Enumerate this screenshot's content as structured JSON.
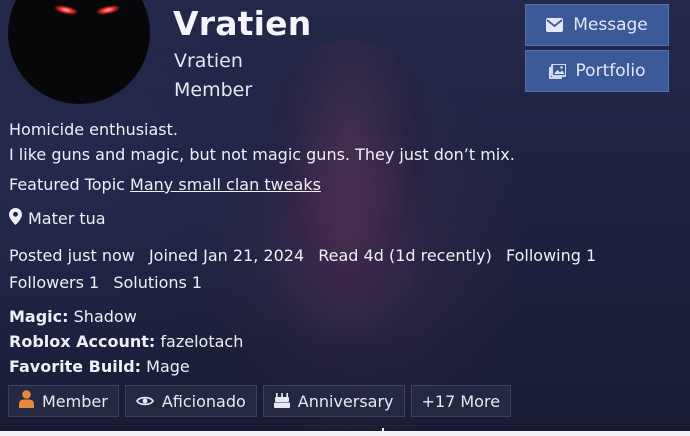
{
  "profile": {
    "display_name": "Vratien",
    "username": "Vratien",
    "title": "Member",
    "bio_line1": "Homicide enthusiast.",
    "bio_line2": "I like guns and magic, but not magic guns. They just don’t mix.",
    "featured_label": "Featured Topic",
    "featured_topic": "Many small clan tweaks",
    "location": "Mater tua"
  },
  "actions": {
    "message_label": "Message",
    "portfolio_label": "Portfolio"
  },
  "stats": {
    "posted": "Posted just now",
    "joined": "Joined Jan 21, 2024",
    "read": "Read 4d (1d recently)",
    "following": "Following 1",
    "followers": "Followers 1",
    "solutions": "Solutions 1"
  },
  "fields": [
    {
      "label": "Magic:",
      "value": "Shadow"
    },
    {
      "label": "Roblox Account:",
      "value": "fazelotach"
    },
    {
      "label": "Favorite Build:",
      "value": "Mage"
    }
  ],
  "badges": [
    {
      "label": "Member",
      "icon": "person-icon",
      "icon_color": "#e8893a"
    },
    {
      "label": "Aficionado",
      "icon": "eye-icon"
    },
    {
      "label": "Anniversary",
      "icon": "cake-icon"
    },
    {
      "label": "+17 More"
    }
  ],
  "colors": {
    "button_bg": "#3b5899",
    "background": "#1c2039",
    "avatar_eyes": "#ff2a2a"
  }
}
